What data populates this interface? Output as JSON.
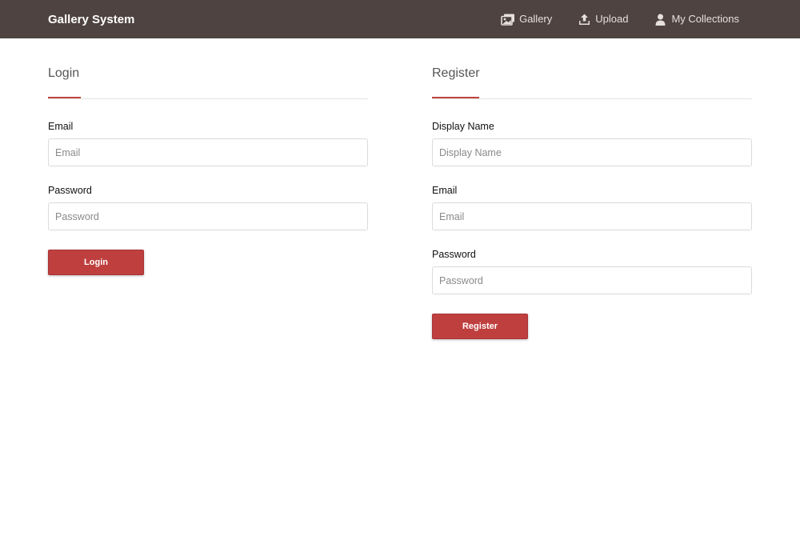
{
  "app": {
    "brand": "Gallery System"
  },
  "nav": {
    "items": [
      {
        "label": "Gallery",
        "icon": "images-icon"
      },
      {
        "label": "Upload",
        "icon": "upload-icon"
      },
      {
        "label": "My Collections",
        "icon": "user-icon"
      }
    ]
  },
  "login": {
    "title": "Login",
    "email_label": "Email",
    "email_placeholder": "Email",
    "email_value": "",
    "password_label": "Password",
    "password_placeholder": "Password",
    "password_value": "",
    "submit_label": "Login"
  },
  "register": {
    "title": "Register",
    "display_name_label": "Display Name",
    "display_name_placeholder": "Display Name",
    "display_name_value": "",
    "email_label": "Email",
    "email_placeholder": "Email",
    "email_value": "",
    "password_label": "Password",
    "password_placeholder": "Password",
    "password_value": "",
    "submit_label": "Register"
  },
  "colors": {
    "navbar": "#4e4341",
    "accent": "#bf3f3f",
    "nav_text": "#e6e0de"
  }
}
